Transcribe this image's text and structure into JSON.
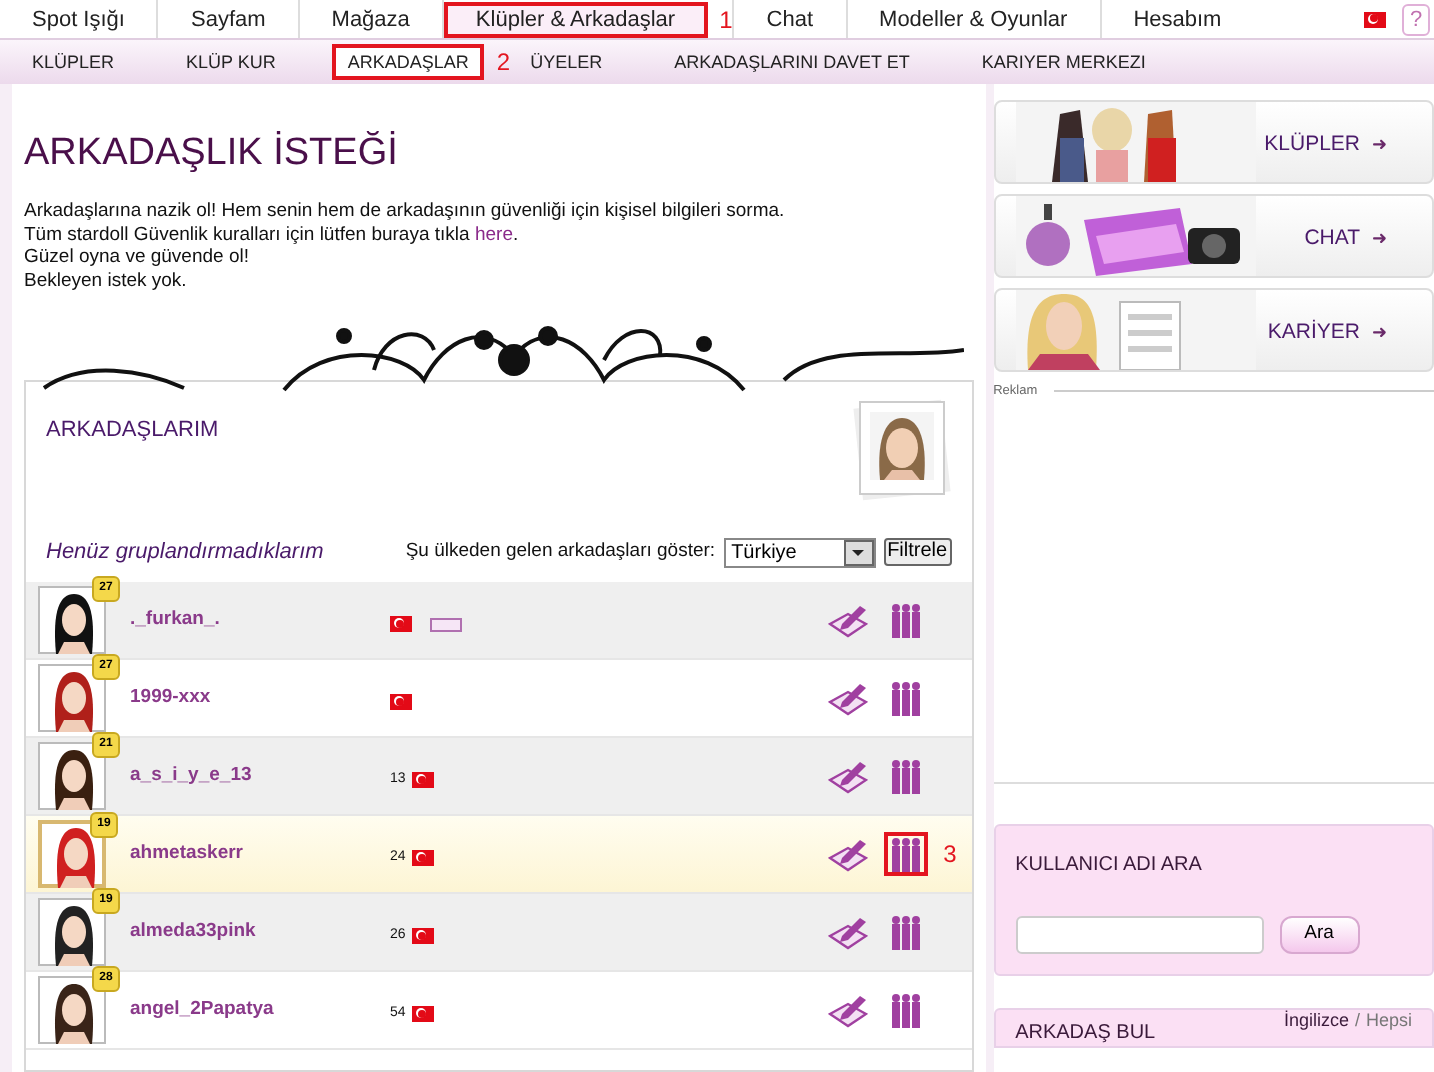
{
  "top_nav": [
    {
      "label": "Spot Işığı",
      "selected": false
    },
    {
      "label": "Sayfam",
      "selected": false
    },
    {
      "label": "Mağaza",
      "selected": false
    },
    {
      "label": "Klüpler & Arkadaşlar",
      "selected": true,
      "annotation": "1"
    },
    {
      "label": "Chat",
      "selected": false
    },
    {
      "label": "Modeller & Oyunlar",
      "selected": false
    },
    {
      "label": "Hesabım",
      "selected": false
    }
  ],
  "help_icon": "?",
  "sub_nav": [
    {
      "label": "KLÜPLER",
      "selected": false
    },
    {
      "label": "KLÜP KUR",
      "selected": false
    },
    {
      "label": "ARKADAŞLAR",
      "selected": true,
      "annotation": "2"
    },
    {
      "label": "ÜYELER",
      "selected": false
    },
    {
      "label": "ARKADAŞLARINI DAVET ET",
      "selected": false
    },
    {
      "label": "KARIYER MERKEZI",
      "selected": false
    }
  ],
  "page_title": "ARKADAŞLIK İSTEĞİ",
  "intro": [
    "Arkadaşlarına nazik ol! Hem senin hem de arkadaşının güvenliği için kişisel bilgileri sorma.",
    "Tüm stardoll Güvenlik kuralları için lütfen buraya tıkla ",
    "Güzel oyna ve güvende ol!",
    "Bekleyen istek yok."
  ],
  "intro_link": "here",
  "intro_link_end": ".",
  "friends": {
    "title": "ARKADAŞLARIM",
    "group_title": "Henüz gruplandırmadıklarım",
    "filter_label": "Şu ülkeden gelen arkadaşları göster:",
    "country": "Türkiye",
    "filter_button": "Filtrele",
    "rows": [
      {
        "name": "._furkan_.",
        "badge": "27",
        "age": "",
        "profile_card": true,
        "highlighted": false
      },
      {
        "name": "1999-xxx",
        "badge": "27",
        "age": "",
        "profile_card": false,
        "highlighted": false
      },
      {
        "name": "a_s_i_y_e_13",
        "badge": "21",
        "age": "13",
        "profile_card": false,
        "highlighted": false
      },
      {
        "name": "ahmetaskerr",
        "badge": "19",
        "age": "24",
        "profile_card": false,
        "highlighted": true,
        "annotation": "3"
      },
      {
        "name": "almeda33pink",
        "badge": "19",
        "age": "26",
        "profile_card": false,
        "highlighted": false
      },
      {
        "name": "angel_2Papatya",
        "badge": "28",
        "age": "54",
        "profile_card": false,
        "highlighted": false
      }
    ]
  },
  "promos": [
    {
      "label": "KLÜPLER",
      "arrow": "➜"
    },
    {
      "label": "CHAT",
      "arrow": "➜"
    },
    {
      "label": "KARİYER",
      "arrow": "➜"
    }
  ],
  "ad_label": "Reklam",
  "user_search": {
    "title": "KULLANICI ADI ARA",
    "button": "Ara"
  },
  "find_friend": {
    "title": "ARKADAŞ BUL",
    "language": "İngilizce",
    "separator": "/",
    "all": "Hepsi"
  }
}
